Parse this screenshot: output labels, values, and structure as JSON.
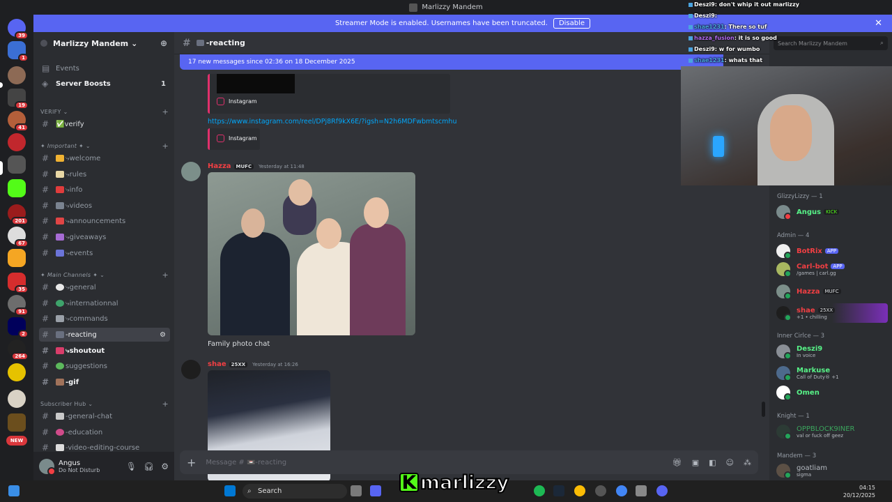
{
  "window": {
    "title": "Marlizzy Mandem"
  },
  "banner": {
    "text": "Streamer Mode is enabled. Usernames have been truncated.",
    "button": "Disable"
  },
  "servers": {
    "badges": [
      "39",
      "1",
      "19",
      "41",
      "201",
      "67",
      "35",
      "91",
      "2",
      "264",
      "NEW"
    ]
  },
  "guild": {
    "name": "Marlizzy Mandem"
  },
  "sidebar": {
    "events": "Events",
    "boosts": "Server Boosts",
    "boosts_count": "1",
    "categories": [
      "VERIFY",
      "✦ Important ✦",
      "✦ Main Channels ✦",
      "Subscriber Hub"
    ],
    "channels": [
      {
        "label": "✅verify"
      },
      {
        "label": "⤷welcome"
      },
      {
        "label": "⤷rules"
      },
      {
        "label": "⤷info"
      },
      {
        "label": "⤷videos"
      },
      {
        "label": "⤷announcements"
      },
      {
        "label": "⤷giveaways"
      },
      {
        "label": "⤷events"
      },
      {
        "label": "⤷general"
      },
      {
        "label": "⤷internationnal"
      },
      {
        "label": "⤷commands"
      },
      {
        "label": "-reacting"
      },
      {
        "label": "⤷shoutout"
      },
      {
        "label": "suggestions"
      },
      {
        "label": "-gif"
      },
      {
        "label": "-general-chat"
      },
      {
        "label": "-education"
      },
      {
        "label": "-video-editing-course"
      }
    ]
  },
  "user": {
    "name": "Angus",
    "status": "Do Not Disturb"
  },
  "chat": {
    "channel": "-reacting",
    "new_messages": "17 new messages since 02:36 on 18 December 2025",
    "embed_label": "Instagram",
    "link": "https://www.instagram.com/reel/DPj8Rf9kX6E/?igsh=N2h6MDFwbmtscmhu",
    "messages": [
      {
        "author": "Hazza",
        "tag": "MUFC",
        "time": "Yesterday at 11:48",
        "text": "Family photo chat",
        "color": "#f23f43"
      },
      {
        "author": "shae",
        "tag": "25XX",
        "time": "Yesterday at 16:26",
        "color": "#f23f43"
      }
    ],
    "composer_placeholder": "Message # 📼-reacting"
  },
  "members": {
    "search_placeholder": "Search Marlizzy Mandem",
    "groups": [
      {
        "title": "GlizzyLizzy — 1",
        "members": [
          {
            "name": "Angus",
            "tag": "KICK",
            "color": "#57f287"
          }
        ]
      },
      {
        "title": "Admin — 4",
        "members": [
          {
            "name": "BotRix",
            "tag": "APP",
            "color": "#f23f43"
          },
          {
            "name": "Carl-bot",
            "tag": "APP",
            "sub": "/games | carl.gg",
            "color": "#f23f43"
          },
          {
            "name": "Hazza",
            "tag": "MUFC",
            "color": "#f23f43"
          },
          {
            "name": "shae",
            "tag": "25XX",
            "sub": "+1 • chilling",
            "color": "#f23f43"
          }
        ]
      },
      {
        "title": "Inner Cirlce — 3",
        "members": [
          {
            "name": "Deszi9",
            "sub": "In voice",
            "color": "#57f287"
          },
          {
            "name": "Markuse",
            "sub": "Call of Duty® +1",
            "color": "#57f287"
          },
          {
            "name": "Omen",
            "color": "#57f287"
          }
        ]
      },
      {
        "title": "Knight — 1",
        "members": [
          {
            "name": "OPPBLOCK9INER",
            "sub": "val or fuck off geez",
            "color": "#3ba55d"
          }
        ]
      },
      {
        "title": "Mandem — 3",
        "members": [
          {
            "name": "goatliam",
            "sub": "sigma",
            "color": "#b5bac1"
          }
        ]
      }
    ]
  },
  "overlay": {
    "lines": [
      {
        "user": "Deszi9",
        "text": ": don't whip it out marlizzy"
      },
      {
        "user": "Deszi9",
        "text": ":"
      },
      {
        "user": "shae1231",
        "text": ": There so tuf"
      },
      {
        "user": "hazza_fusion",
        "text": ": it is so good"
      },
      {
        "user": "Deszi9",
        "text": ": w for wumbo"
      },
      {
        "user": "shae1231",
        "text": ": whats that"
      }
    ]
  },
  "taskbar": {
    "search": "Search",
    "time": "04:15",
    "date": "20/12/2025"
  },
  "watermark": {
    "text": "marlizzy",
    "logo": "K"
  }
}
